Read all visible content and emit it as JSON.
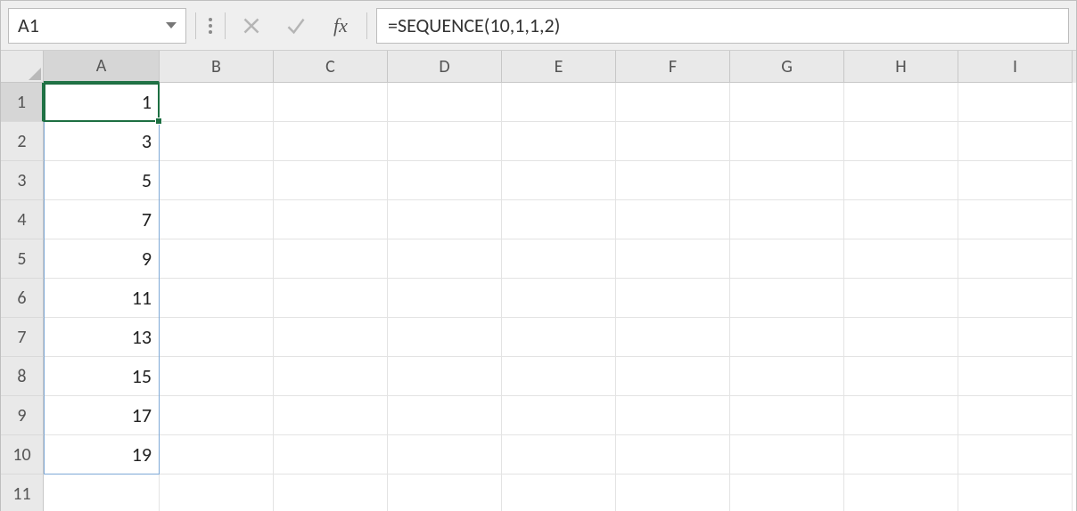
{
  "colors": {
    "accent_green": "#1d6f42",
    "spill_blue": "#7ea8d6"
  },
  "name_box": {
    "value": "A1"
  },
  "formula_bar": {
    "cancel_tooltip": "Cancel",
    "enter_tooltip": "Enter",
    "fx_label": "fx",
    "formula": "=SEQUENCE(10,1,1,2)"
  },
  "columns": [
    "A",
    "B",
    "C",
    "D",
    "E",
    "F",
    "G",
    "H",
    "I"
  ],
  "rows": [
    "1",
    "2",
    "3",
    "4",
    "5",
    "6",
    "7",
    "8",
    "9",
    "10",
    "11"
  ],
  "active": {
    "cell": "A1",
    "col_index": 0,
    "row_index": 0
  },
  "spill_range": {
    "from": "A1",
    "to": "A10",
    "col_index": 0,
    "row_start": 0,
    "row_end": 9
  },
  "cells": {
    "A": [
      "1",
      "3",
      "5",
      "7",
      "9",
      "11",
      "13",
      "15",
      "17",
      "19",
      ""
    ],
    "B": [
      "",
      "",
      "",
      "",
      "",
      "",
      "",
      "",
      "",
      "",
      ""
    ],
    "C": [
      "",
      "",
      "",
      "",
      "",
      "",
      "",
      "",
      "",
      "",
      ""
    ],
    "D": [
      "",
      "",
      "",
      "",
      "",
      "",
      "",
      "",
      "",
      "",
      ""
    ],
    "E": [
      "",
      "",
      "",
      "",
      "",
      "",
      "",
      "",
      "",
      "",
      ""
    ],
    "F": [
      "",
      "",
      "",
      "",
      "",
      "",
      "",
      "",
      "",
      "",
      ""
    ],
    "G": [
      "",
      "",
      "",
      "",
      "",
      "",
      "",
      "",
      "",
      "",
      ""
    ],
    "H": [
      "",
      "",
      "",
      "",
      "",
      "",
      "",
      "",
      "",
      "",
      ""
    ],
    "I": [
      "",
      "",
      "",
      "",
      "",
      "",
      "",
      "",
      "",
      "",
      ""
    ]
  }
}
